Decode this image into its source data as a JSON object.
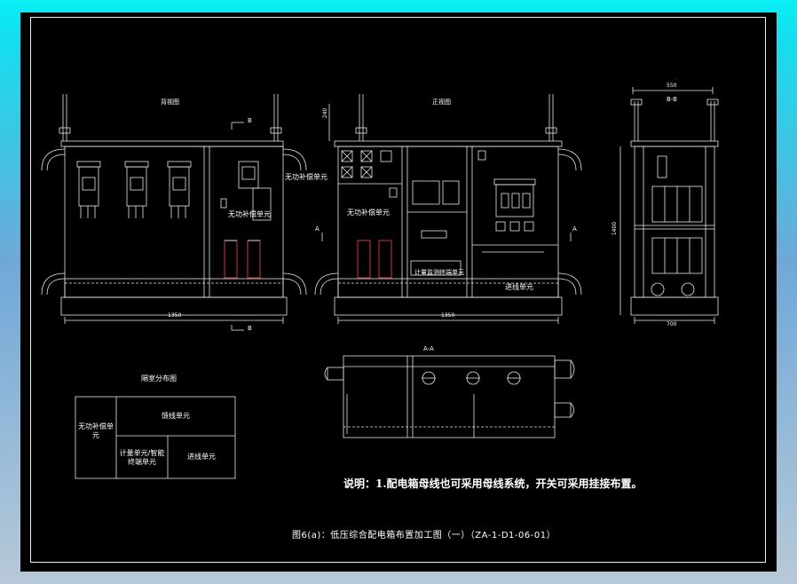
{
  "views": {
    "front_title": "背视图",
    "side_title": "正视图",
    "bb_title": "B-B",
    "aa_title": "A-A",
    "layout_title": "隔室分布图"
  },
  "labels": {
    "cap_unit_left": "无功补偿单元",
    "cap_unit_left2": "无功补偿单元",
    "cap_unit_mid": "无功补偿单元",
    "meter_unit": "计量监测终端单元",
    "outgoing_unit": "进线单元",
    "section_b_top": "B",
    "section_b_bottom": "B",
    "section_a_left": "A",
    "section_a_right": "A"
  },
  "dimensions": {
    "front_width": "1350",
    "side_width": "1350",
    "side_height": "240",
    "bb_top": "550",
    "bb_bottom": "700",
    "bb_height": "1400"
  },
  "layout_table": {
    "left": "无功补偿单元",
    "top_right": "馈线单元",
    "bottom_mid": "计量单元/智能终端单元",
    "bottom_right": "进线单元"
  },
  "note": "说明：1.配电箱母线也可采用母线系统，开关可采用挂接布置。",
  "caption": "图6(a)：低压综合配电箱布置加工图（一）（ZA-1-D1-06-01）"
}
